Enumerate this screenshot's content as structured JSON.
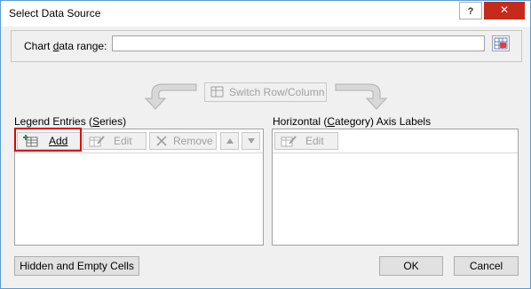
{
  "window": {
    "title": "Select Data Source",
    "help_label": "?",
    "close_label": "✕"
  },
  "data_range": {
    "label_pre": "Chart ",
    "label_accel": "d",
    "label_post": "ata range:",
    "value": ""
  },
  "switch_button": {
    "label": "Switch Row/Column"
  },
  "legend": {
    "header_pre": "Legend Entries (",
    "header_accel": "S",
    "header_post": "eries)",
    "add_label": "Add",
    "edit_label": "Edit",
    "remove_label": "Remove",
    "entries": []
  },
  "axis": {
    "header_pre": "Horizontal (",
    "header_accel": "C",
    "header_post": "ategory) Axis Labels",
    "edit_label": "Edit",
    "entries": []
  },
  "footer": {
    "hidden_cells_label": "Hidden and Empty Cells",
    "ok_label": "OK",
    "cancel_label": "Cancel"
  },
  "colors": {
    "highlight": "#e00000",
    "close": "#c42b1c",
    "window_border": "#5b9bd5"
  },
  "icons": {
    "range_picker": "range-select-icon",
    "add": "add-series-icon",
    "edit": "edit-icon",
    "remove": "remove-x-icon",
    "move_up": "triangle-up-icon",
    "move_down": "triangle-down-icon",
    "switch": "switch-row-column-icon"
  }
}
